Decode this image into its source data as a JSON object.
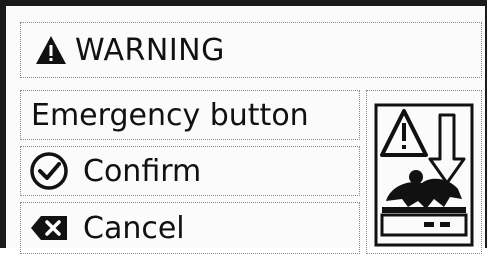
{
  "dialog": {
    "title": "WARNING",
    "message": "Emergency button",
    "confirm_label": "Confirm",
    "cancel_label": "Cancel"
  },
  "icons": {
    "title_icon": "warning-triangle-icon",
    "confirm_icon": "check-circle-icon",
    "cancel_icon": "backspace-x-icon",
    "illustration": "emergency-stop-hazard-icon"
  },
  "colors": {
    "frame": "#1a1a1a",
    "dotted_border": "#6f8fb8",
    "background": "#fbfbfb"
  }
}
